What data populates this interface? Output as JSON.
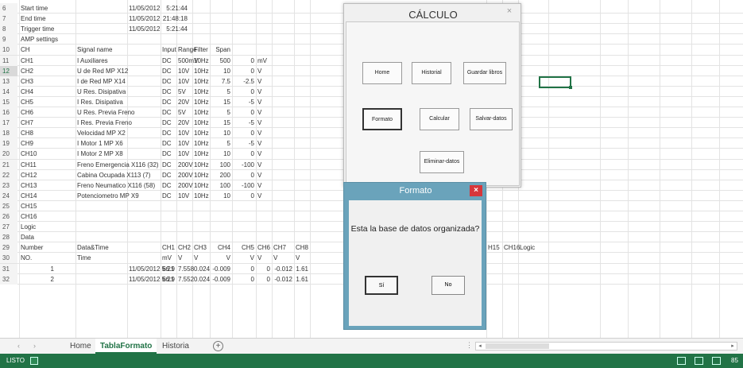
{
  "rows": [
    {
      "num": "6",
      "c": {
        "A": "Start time",
        "C": "11/05/2012",
        "Cb": "5:21:44"
      }
    },
    {
      "num": "7",
      "c": {
        "A": "End time",
        "C": "11/05/2012",
        "Cb": "21:48:18"
      }
    },
    {
      "num": "8",
      "c": {
        "A": "Trigger time",
        "C": "11/05/2012",
        "Cb": "5:21:44"
      }
    },
    {
      "num": "9",
      "c": {
        "A": "AMP settings"
      }
    },
    {
      "num": "10",
      "c": {
        "A": "CH",
        "B": "Signal name",
        "D": "Input",
        "E": "Range",
        "F": "Filter",
        "G": "Span"
      }
    },
    {
      "num": "11",
      "c": {
        "A": "CH1",
        "B": "I Auxiliares",
        "D": "DC",
        "E": "500mV",
        "F": "10Hz",
        "G": "500",
        "H": "0",
        "Hu": "mV"
      }
    },
    {
      "num": "12",
      "c": {
        "A": "CH2",
        "B": "U de Red MP X12",
        "D": "DC",
        "E": "10V",
        "F": "10Hz",
        "G": "10",
        "H": "0",
        "Hu": "V"
      }
    },
    {
      "num": "13",
      "c": {
        "A": "CH3",
        "B": "I de Red  MP X14",
        "D": "DC",
        "E": "10V",
        "F": "10Hz",
        "G": "7.5",
        "H": "-2.5",
        "Hu": "V"
      }
    },
    {
      "num": "14",
      "c": {
        "A": "CH4",
        "B": "U Res. Disipativa",
        "D": "DC",
        "E": "5V",
        "F": "10Hz",
        "G": "5",
        "H": "0",
        "Hu": "V"
      }
    },
    {
      "num": "15",
      "c": {
        "A": "CH5",
        "B": "I Res. Disipativa",
        "D": "DC",
        "E": "20V",
        "F": "10Hz",
        "G": "15",
        "H": "-5",
        "Hu": "V"
      }
    },
    {
      "num": "16",
      "c": {
        "A": "CH6",
        "B": "U Res. Previa Freno",
        "D": "DC",
        "E": "5V",
        "F": "10Hz",
        "G": "5",
        "H": "0",
        "Hu": "V"
      }
    },
    {
      "num": "17",
      "c": {
        "A": "CH7",
        "B": "I Res. Previa Freno",
        "D": "DC",
        "E": "20V",
        "F": "10Hz",
        "G": "15",
        "H": "-5",
        "Hu": "V"
      }
    },
    {
      "num": "18",
      "c": {
        "A": "CH8",
        "B": "Velocidad MP X2",
        "D": "DC",
        "E": "10V",
        "F": "10Hz",
        "G": "10",
        "H": "0",
        "Hu": "V"
      }
    },
    {
      "num": "19",
      "c": {
        "A": "CH9",
        "B": "I Motor 1 MP X6",
        "D": "DC",
        "E": "10V",
        "F": "10Hz",
        "G": "5",
        "H": "-5",
        "Hu": "V"
      }
    },
    {
      "num": "20",
      "c": {
        "A": "CH10",
        "B": "I Motor 2 MP X8",
        "D": "DC",
        "E": "10V",
        "F": "10Hz",
        "G": "10",
        "H": "0",
        "Hu": "V"
      }
    },
    {
      "num": "21",
      "c": {
        "A": "CH11",
        "B": "Freno Emergencia X116 (32)",
        "D": "DC",
        "E": "200V",
        "F": "10Hz",
        "G": "100",
        "H": "-100",
        "Hu": "V"
      }
    },
    {
      "num": "22",
      "c": {
        "A": "CH12",
        "B": "Cabina Ocupada X113 (7)",
        "D": "DC",
        "E": "200V",
        "F": "10Hz",
        "G": "200",
        "H": "0",
        "Hu": "V"
      }
    },
    {
      "num": "23",
      "c": {
        "A": "CH13",
        "B": "Freno Neumatico X116 (58)",
        "D": "DC",
        "E": "200V",
        "F": "10Hz",
        "G": "100",
        "H": "-100",
        "Hu": "V"
      }
    },
    {
      "num": "24",
      "c": {
        "A": "CH14",
        "B": "Potenciometro MP X9",
        "D": "DC",
        "E": "10V",
        "F": "10Hz",
        "G": "10",
        "H": "0",
        "Hu": "V"
      }
    },
    {
      "num": "25",
      "c": {
        "A": "CH15"
      }
    },
    {
      "num": "26",
      "c": {
        "A": "CH16"
      }
    },
    {
      "num": "27",
      "c": {
        "A": "Logic"
      }
    },
    {
      "num": "28",
      "c": {
        "A": "Data"
      }
    },
    {
      "num": "29",
      "c": {
        "A": "Number",
        "B": "Data&Time",
        "D": "CH1",
        "E": "CH2",
        "F": "CH3",
        "G": "CH4",
        "H": "CH5",
        "I": "CH6",
        "J": "CH7",
        "K": "CH8",
        "R": "H15",
        "S": "CH16",
        "T": "Logic"
      }
    },
    {
      "num": "30",
      "c": {
        "A": "NO.",
        "B": "Time",
        "D": "mV",
        "E": "V",
        "F": "V",
        "G": "V",
        "H": "V",
        "I": "V",
        "J": "V",
        "K": "V"
      }
    },
    {
      "num": "31",
      "c": {
        "Anum": "1",
        "C": "11/05/2012 5:21",
        "D": "66.9",
        "E": "7.558",
        "F": "0.024",
        "G": "-0.009",
        "H": "0",
        "I": "0",
        "J": "-0.012",
        "K": "1.61"
      }
    },
    {
      "num": "32",
      "c": {
        "Anum": "2",
        "C": "11/05/2012 5:21",
        "D": "66.9",
        "E": "7.552",
        "F": "0.024",
        "G": "-0.009",
        "H": "0",
        "I": "0",
        "J": "-0.012",
        "K": "1.61"
      }
    }
  ],
  "dialog_calculo": {
    "title": "CÁLCULO",
    "close": "×",
    "buttons": {
      "home": "Home",
      "historial": "Historial",
      "guardar_libros": "Guardar libros",
      "formato": "Formato",
      "calcular": "Calcular",
      "salvar_datos": "Salvar-datos",
      "eliminar_datos": "Eliminar-datos"
    }
  },
  "dialog_formato": {
    "title": "Formato",
    "close": "×",
    "message": "Esta la base de datos organizada?",
    "yes": "Sí",
    "no": "No"
  },
  "tabs": {
    "home": "Home",
    "tablaformato": "TablaFormato",
    "historia": "Historia",
    "add": "+",
    "nav_prev": "‹",
    "nav_next": "›"
  },
  "statusbar": {
    "status": "LISTO",
    "zoom": "85"
  },
  "colors": {
    "accent": "#217346",
    "dialog_frame": "#6aa3bb",
    "close_red": "#d6363a"
  }
}
